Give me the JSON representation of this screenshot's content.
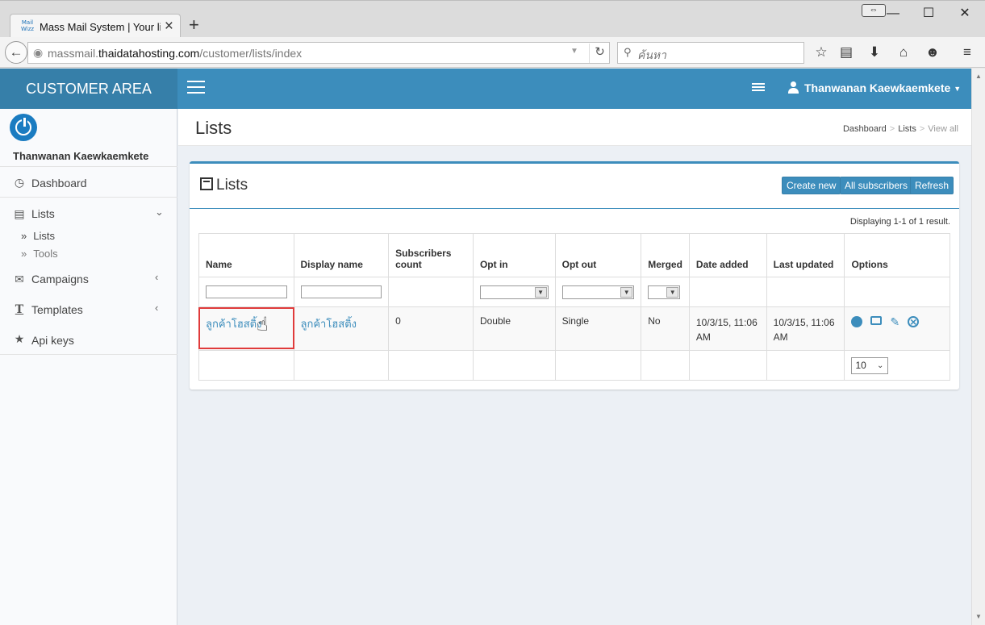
{
  "browser": {
    "tab_title": "Mass Mail System | Your li...",
    "favicon_text": "Mail\nWizz",
    "url_host_prefix": "massmail.",
    "url_host": "thaidatahosting.com",
    "url_path": "/customer/lists/index",
    "search_placeholder": "ค้นหา"
  },
  "header": {
    "logo": "CUSTOMER AREA",
    "user_name": "Thanwanan Kaewkaemkete"
  },
  "sidebar": {
    "user_name": "Thanwanan Kaewkaemkete",
    "items": [
      {
        "label": "Dashboard",
        "icon": "dashboard-icon"
      },
      {
        "label": "Lists",
        "icon": "list-icon"
      },
      {
        "label": "Campaigns",
        "icon": "envelope-icon"
      },
      {
        "label": "Templates",
        "icon": "text-icon"
      },
      {
        "label": "Api keys",
        "icon": "star-icon"
      }
    ],
    "sub_items": [
      "Lists",
      "Tools"
    ]
  },
  "content": {
    "page_title": "Lists",
    "breadcrumb": [
      "Dashboard",
      "Lists",
      "View all"
    ]
  },
  "box": {
    "title": "Lists",
    "buttons": [
      "Create new",
      "All subscribers",
      "Refresh"
    ],
    "summary": "Displaying 1-1 of 1 result.",
    "columns": [
      "Name",
      "Display name",
      "Subscribers count",
      "Opt in",
      "Opt out",
      "Merged",
      "Date added",
      "Last updated",
      "Options"
    ],
    "rows": [
      {
        "name": "ลูกค้าโฮสติ้ง",
        "display_name": "ลูกค้าโฮสติ้ง",
        "subscribers_count": "0",
        "opt_in": "Double",
        "opt_out": "Single",
        "merged": "No",
        "date_added": "10/3/15, 11:06 AM",
        "last_updated": "10/3/15, 11:06 AM"
      }
    ],
    "page_size": "10"
  },
  "colors": {
    "header": "#3c8dbc",
    "logo_bg": "#367fa9",
    "highlight": "#e03b3b"
  }
}
